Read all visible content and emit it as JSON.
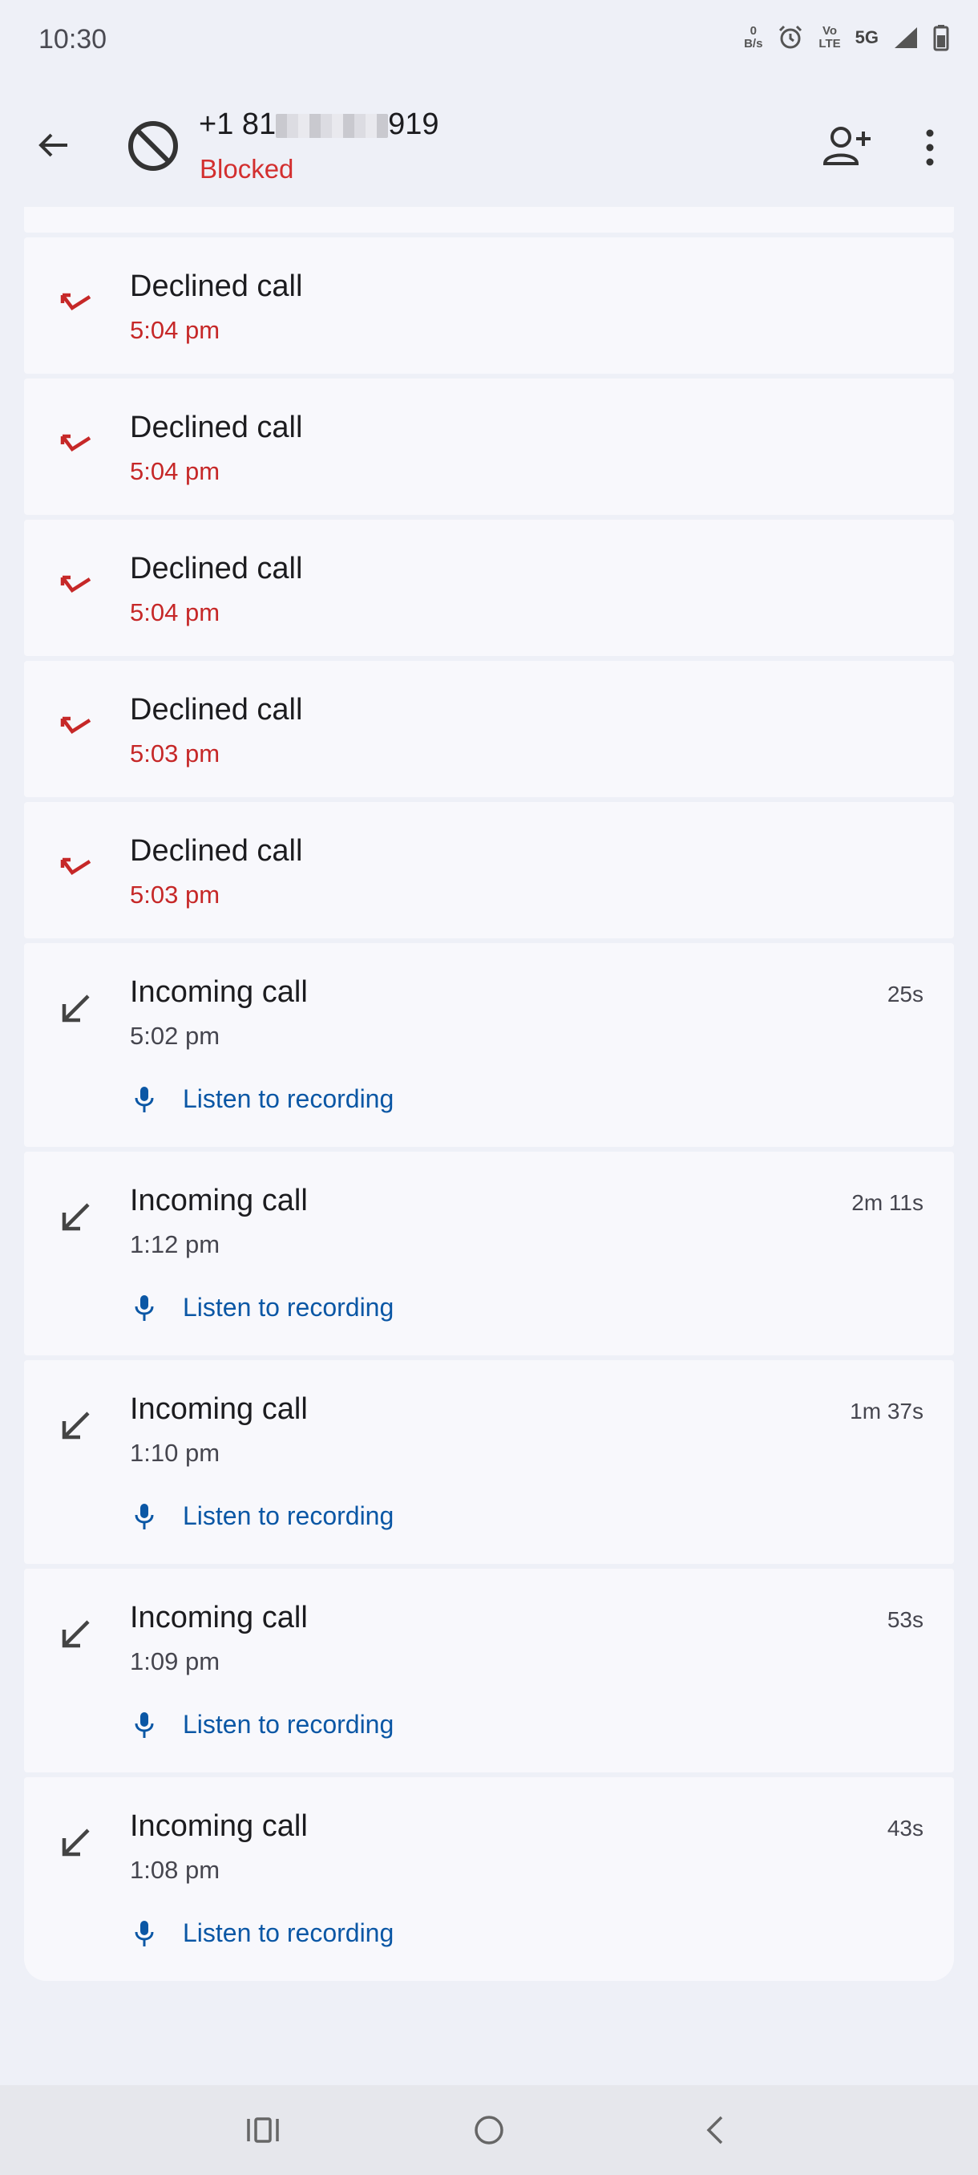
{
  "status_bar": {
    "time": "10:30",
    "data_speed": {
      "value": "0",
      "unit": "B/s"
    },
    "volte": {
      "line1": "Vo",
      "line2": "LTE"
    },
    "network": "5G",
    "icons": [
      "data-speed-icon",
      "alarm-icon",
      "volte-icon",
      "signal-icon",
      "battery-icon"
    ]
  },
  "header": {
    "number_prefix": "+1 81",
    "number_suffix": "919",
    "status": "Blocked",
    "icons": [
      "back-arrow-icon",
      "blocked-icon",
      "add-contact-icon",
      "more-vert-icon"
    ]
  },
  "colors": {
    "background": "#eef0f7",
    "card": "#f8f8fc",
    "declined": "#c62828",
    "blocked": "#d32f2f",
    "link": "#0b57a5"
  },
  "calls": [
    {
      "type": "declined",
      "title": "Declined call",
      "time": "5:04 pm"
    },
    {
      "type": "declined",
      "title": "Declined call",
      "time": "5:04 pm"
    },
    {
      "type": "declined",
      "title": "Declined call",
      "time": "5:04 pm"
    },
    {
      "type": "declined",
      "title": "Declined call",
      "time": "5:03 pm"
    },
    {
      "type": "declined",
      "title": "Declined call",
      "time": "5:03 pm"
    },
    {
      "type": "incoming",
      "title": "Incoming call",
      "time": "5:02 pm",
      "duration": "25s",
      "recording_label": "Listen to recording"
    },
    {
      "type": "incoming",
      "title": "Incoming call",
      "time": "1:12 pm",
      "duration": "2m 11s",
      "recording_label": "Listen to recording"
    },
    {
      "type": "incoming",
      "title": "Incoming call",
      "time": "1:10 pm",
      "duration": "1m 37s",
      "recording_label": "Listen to recording"
    },
    {
      "type": "incoming",
      "title": "Incoming call",
      "time": "1:09 pm",
      "duration": "53s",
      "recording_label": "Listen to recording"
    },
    {
      "type": "incoming",
      "title": "Incoming call",
      "time": "1:08 pm",
      "duration": "43s",
      "recording_label": "Listen to recording"
    }
  ],
  "nav_bar": {
    "icons": [
      "recent-apps-icon",
      "home-icon",
      "back-icon"
    ]
  }
}
